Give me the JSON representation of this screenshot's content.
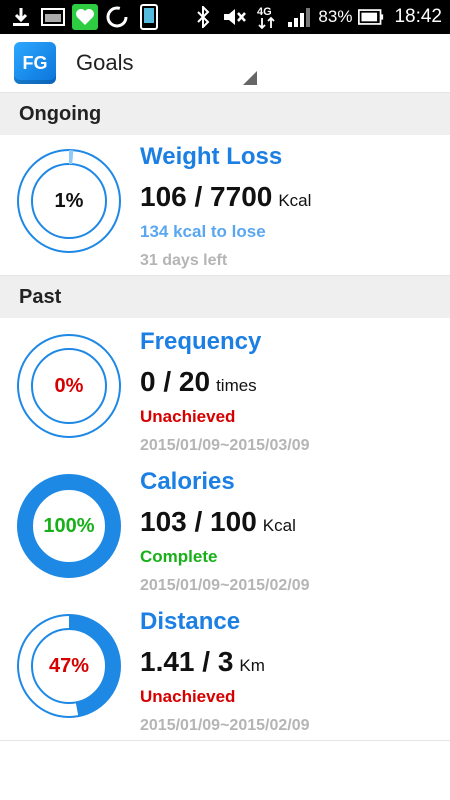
{
  "status_bar": {
    "battery_percent": "83%",
    "time": "18:42",
    "network": "4G"
  },
  "action_bar": {
    "logo_text": "FG",
    "title": "Goals"
  },
  "sections": {
    "ongoing": "Ongoing",
    "past": "Past"
  },
  "ongoing_goals": [
    {
      "title": "Weight Loss",
      "percent_label": "1%",
      "progress": 0.014,
      "value": "106 / 7700",
      "unit": "Kcal",
      "status": "134 kcal to lose",
      "period": "31 days left"
    }
  ],
  "past_goals": [
    {
      "title": "Frequency",
      "percent_label": "0%",
      "progress": 0,
      "value": "0 / 20",
      "unit": "times",
      "status": "Unachieved",
      "period": "2015/01/09~2015/03/09"
    },
    {
      "title": "Calories",
      "percent_label": "100%",
      "progress": 1,
      "value": "103 / 100",
      "unit": "Kcal",
      "status": "Complete",
      "period": "2015/01/09~2015/02/09"
    },
    {
      "title": "Distance",
      "percent_label": "47%",
      "progress": 0.47,
      "value": "1.41 / 3",
      "unit": "Km",
      "status": "Unachieved",
      "period": "2015/01/09~2015/02/09"
    }
  ],
  "colors": {
    "accent_blue": "#1c7fe3",
    "ring_blue": "#1e88e5",
    "ring_light": "#90caf9",
    "status_pending": "#5aa7f0",
    "status_unachieved": "#d60000",
    "status_complete": "#18b018",
    "muted": "#b5b5b5"
  }
}
